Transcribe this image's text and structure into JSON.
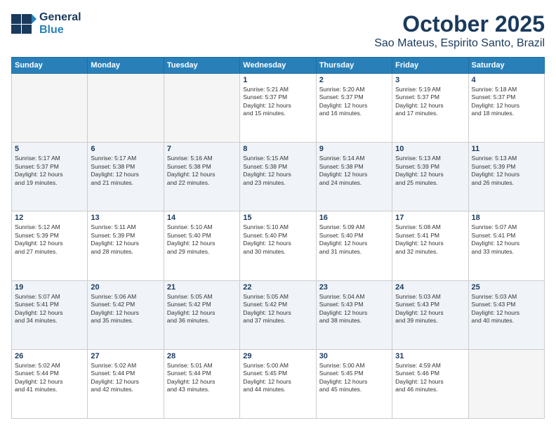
{
  "logo": {
    "line1": "General",
    "line2": "Blue"
  },
  "title": "October 2025",
  "subtitle": "Sao Mateus, Espirito Santo, Brazil",
  "days_of_week": [
    "Sunday",
    "Monday",
    "Tuesday",
    "Wednesday",
    "Thursday",
    "Friday",
    "Saturday"
  ],
  "weeks": [
    [
      {
        "num": "",
        "info": ""
      },
      {
        "num": "",
        "info": ""
      },
      {
        "num": "",
        "info": ""
      },
      {
        "num": "1",
        "info": "Sunrise: 5:21 AM\nSunset: 5:37 PM\nDaylight: 12 hours\nand 15 minutes."
      },
      {
        "num": "2",
        "info": "Sunrise: 5:20 AM\nSunset: 5:37 PM\nDaylight: 12 hours\nand 16 minutes."
      },
      {
        "num": "3",
        "info": "Sunrise: 5:19 AM\nSunset: 5:37 PM\nDaylight: 12 hours\nand 17 minutes."
      },
      {
        "num": "4",
        "info": "Sunrise: 5:18 AM\nSunset: 5:37 PM\nDaylight: 12 hours\nand 18 minutes."
      }
    ],
    [
      {
        "num": "5",
        "info": "Sunrise: 5:17 AM\nSunset: 5:37 PM\nDaylight: 12 hours\nand 19 minutes."
      },
      {
        "num": "6",
        "info": "Sunrise: 5:17 AM\nSunset: 5:38 PM\nDaylight: 12 hours\nand 21 minutes."
      },
      {
        "num": "7",
        "info": "Sunrise: 5:16 AM\nSunset: 5:38 PM\nDaylight: 12 hours\nand 22 minutes."
      },
      {
        "num": "8",
        "info": "Sunrise: 5:15 AM\nSunset: 5:38 PM\nDaylight: 12 hours\nand 23 minutes."
      },
      {
        "num": "9",
        "info": "Sunrise: 5:14 AM\nSunset: 5:38 PM\nDaylight: 12 hours\nand 24 minutes."
      },
      {
        "num": "10",
        "info": "Sunrise: 5:13 AM\nSunset: 5:39 PM\nDaylight: 12 hours\nand 25 minutes."
      },
      {
        "num": "11",
        "info": "Sunrise: 5:13 AM\nSunset: 5:39 PM\nDaylight: 12 hours\nand 26 minutes."
      }
    ],
    [
      {
        "num": "12",
        "info": "Sunrise: 5:12 AM\nSunset: 5:39 PM\nDaylight: 12 hours\nand 27 minutes."
      },
      {
        "num": "13",
        "info": "Sunrise: 5:11 AM\nSunset: 5:39 PM\nDaylight: 12 hours\nand 28 minutes."
      },
      {
        "num": "14",
        "info": "Sunrise: 5:10 AM\nSunset: 5:40 PM\nDaylight: 12 hours\nand 29 minutes."
      },
      {
        "num": "15",
        "info": "Sunrise: 5:10 AM\nSunset: 5:40 PM\nDaylight: 12 hours\nand 30 minutes."
      },
      {
        "num": "16",
        "info": "Sunrise: 5:09 AM\nSunset: 5:40 PM\nDaylight: 12 hours\nand 31 minutes."
      },
      {
        "num": "17",
        "info": "Sunrise: 5:08 AM\nSunset: 5:41 PM\nDaylight: 12 hours\nand 32 minutes."
      },
      {
        "num": "18",
        "info": "Sunrise: 5:07 AM\nSunset: 5:41 PM\nDaylight: 12 hours\nand 33 minutes."
      }
    ],
    [
      {
        "num": "19",
        "info": "Sunrise: 5:07 AM\nSunset: 5:41 PM\nDaylight: 12 hours\nand 34 minutes."
      },
      {
        "num": "20",
        "info": "Sunrise: 5:06 AM\nSunset: 5:42 PM\nDaylight: 12 hours\nand 35 minutes."
      },
      {
        "num": "21",
        "info": "Sunrise: 5:05 AM\nSunset: 5:42 PM\nDaylight: 12 hours\nand 36 minutes."
      },
      {
        "num": "22",
        "info": "Sunrise: 5:05 AM\nSunset: 5:42 PM\nDaylight: 12 hours\nand 37 minutes."
      },
      {
        "num": "23",
        "info": "Sunrise: 5:04 AM\nSunset: 5:43 PM\nDaylight: 12 hours\nand 38 minutes."
      },
      {
        "num": "24",
        "info": "Sunrise: 5:03 AM\nSunset: 5:43 PM\nDaylight: 12 hours\nand 39 minutes."
      },
      {
        "num": "25",
        "info": "Sunrise: 5:03 AM\nSunset: 5:43 PM\nDaylight: 12 hours\nand 40 minutes."
      }
    ],
    [
      {
        "num": "26",
        "info": "Sunrise: 5:02 AM\nSunset: 5:44 PM\nDaylight: 12 hours\nand 41 minutes."
      },
      {
        "num": "27",
        "info": "Sunrise: 5:02 AM\nSunset: 5:44 PM\nDaylight: 12 hours\nand 42 minutes."
      },
      {
        "num": "28",
        "info": "Sunrise: 5:01 AM\nSunset: 5:44 PM\nDaylight: 12 hours\nand 43 minutes."
      },
      {
        "num": "29",
        "info": "Sunrise: 5:00 AM\nSunset: 5:45 PM\nDaylight: 12 hours\nand 44 minutes."
      },
      {
        "num": "30",
        "info": "Sunrise: 5:00 AM\nSunset: 5:45 PM\nDaylight: 12 hours\nand 45 minutes."
      },
      {
        "num": "31",
        "info": "Sunrise: 4:59 AM\nSunset: 5:46 PM\nDaylight: 12 hours\nand 46 minutes."
      },
      {
        "num": "",
        "info": ""
      }
    ]
  ]
}
